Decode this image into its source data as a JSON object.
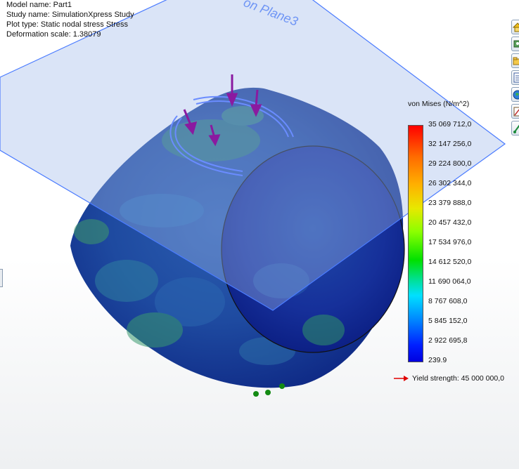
{
  "info": {
    "model_name": "Model name: Part1",
    "study_name": "Study name: SimulationXpress Study",
    "plot_type": "Plot type: Static nodal stress Stress",
    "deformation_scale": "Deformation scale: 1.38079"
  },
  "plane_label": "on Plane3",
  "legend": {
    "title": "von Mises (N/m^2)",
    "ticks": [
      "35 069 712,0",
      "32 147 256,0",
      "29 224 800,0",
      "26 302 344,0",
      "23 379 888,0",
      "20 457 432,0",
      "17 534 976,0",
      "14 612 520,0",
      "11 690 064,0",
      "8 767 608,0",
      "5 845 152,0",
      "2 922 695,8",
      "239.9"
    ]
  },
  "yield": {
    "label": "Yield strength: 45 000 000,0",
    "arrow_color": "#e00000"
  },
  "colors": {
    "plane_edge": "#4a7bff",
    "load_arrows": "#8a1aa0",
    "fixture_markers": "#138a13",
    "part_base": "#1f3f9c"
  },
  "toolbar": {
    "icons": [
      "home-view-icon",
      "select-entity-icon",
      "open-folder-icon",
      "report-icon",
      "web-globe-icon",
      "edit-definition-icon",
      "fixture-pin-icon"
    ]
  }
}
